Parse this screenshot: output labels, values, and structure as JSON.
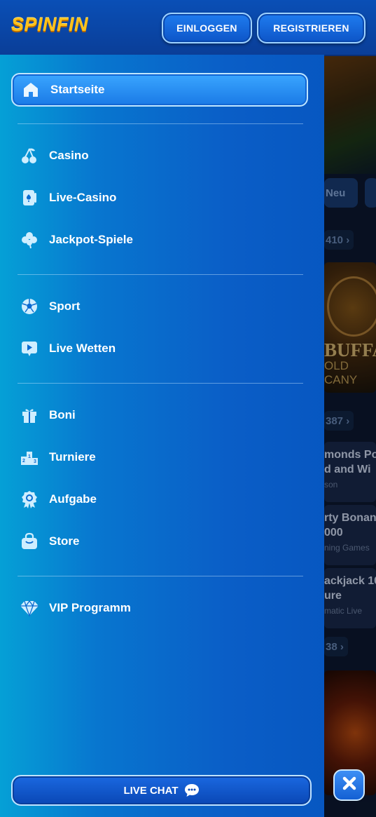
{
  "header": {
    "logo": "SPINFIN",
    "login_label": "EINLOGGEN",
    "register_label": "REGISTRIEREN"
  },
  "menu": {
    "items": [
      {
        "label": "Startseite",
        "icon": "home-icon",
        "active": true
      },
      {
        "label": "Casino",
        "icon": "cherry-icon"
      },
      {
        "label": "Live-Casino",
        "icon": "card-icon"
      },
      {
        "label": "Jackpot-Spiele",
        "icon": "clover-icon"
      },
      {
        "label": "Sport",
        "icon": "soccer-ball-icon"
      },
      {
        "label": "Live Wetten",
        "icon": "play-icon"
      },
      {
        "label": "Boni",
        "icon": "gift-icon"
      },
      {
        "label": "Turniere",
        "icon": "podium-icon"
      },
      {
        "label": "Aufgabe",
        "icon": "badge-icon"
      },
      {
        "label": "Store",
        "icon": "bag-icon"
      },
      {
        "label": "VIP Programm",
        "icon": "diamond-icon"
      }
    ]
  },
  "live_chat_label": "LIVE CHAT",
  "background": {
    "chip_new": "Neu",
    "count_1": "410",
    "buffalo_title": "BUFFAL",
    "buffalo_sub": "OLD CANY",
    "count_2": "387",
    "game_1_title": "monds Po",
    "game_1_title2": "d and Wi",
    "game_1_provider": "son",
    "game_2_title": "rty Bonan",
    "game_2_title2": "000",
    "game_2_provider": "ning Games",
    "game_3_title": "ackjack 10",
    "game_3_title2": "ure",
    "game_3_provider": "matic Live",
    "count_3": "38"
  },
  "colors": {
    "accent": "#0a5ec7",
    "logo": "#ffc21a",
    "button_border": "#9fd3ff"
  }
}
